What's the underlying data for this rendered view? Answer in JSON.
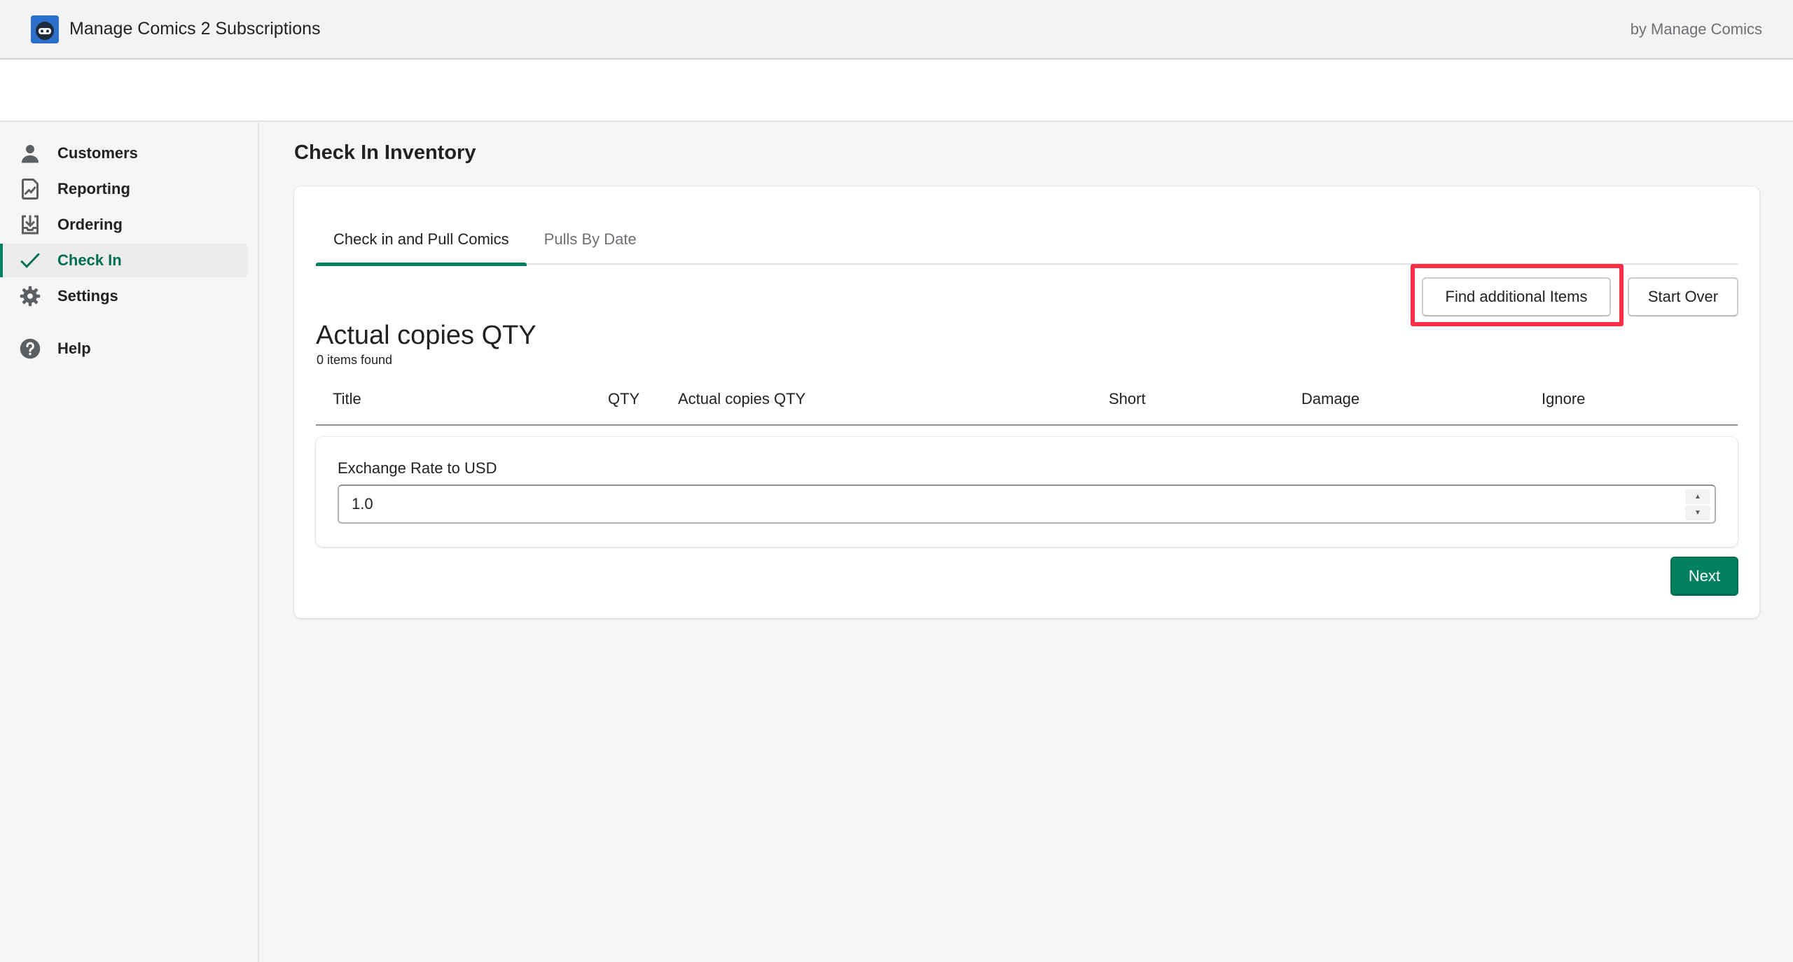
{
  "header": {
    "app_title": "Manage Comics 2 Subscriptions",
    "by_line": "by Manage Comics",
    "logo_icon": "comics-robot-logo-icon",
    "brand_color": "#2c6ecb"
  },
  "sidebar": {
    "items": [
      {
        "label": "Customers",
        "icon": "person-icon"
      },
      {
        "label": "Reporting",
        "icon": "report-icon"
      },
      {
        "label": "Ordering",
        "icon": "import-icon"
      },
      {
        "label": "Check In",
        "icon": "checkmark-icon",
        "active": true
      },
      {
        "label": "Settings",
        "icon": "gear-icon"
      },
      {
        "label": "Help",
        "icon": "question-circle-icon"
      }
    ],
    "active_color": "#008060"
  },
  "main": {
    "page_title": "Check In Inventory",
    "tabs": [
      {
        "label": "Check in and Pull Comics",
        "active": true
      },
      {
        "label": "Pulls By Date",
        "active": false
      }
    ],
    "actions": {
      "find_label": "Find additional Items",
      "start_over_label": "Start Over"
    },
    "highlight_color": "#ff2d46",
    "section_heading": "Actual copies QTY",
    "items_found": "0 items found",
    "table": {
      "columns": [
        "Title",
        "QTY",
        "Actual copies QTY",
        "Short",
        "Damage",
        "Ignore"
      ],
      "rows": []
    },
    "exchange": {
      "label": "Exchange Rate to USD",
      "value": "1.0"
    },
    "next_label": "Next",
    "primary_color": "#008060"
  }
}
